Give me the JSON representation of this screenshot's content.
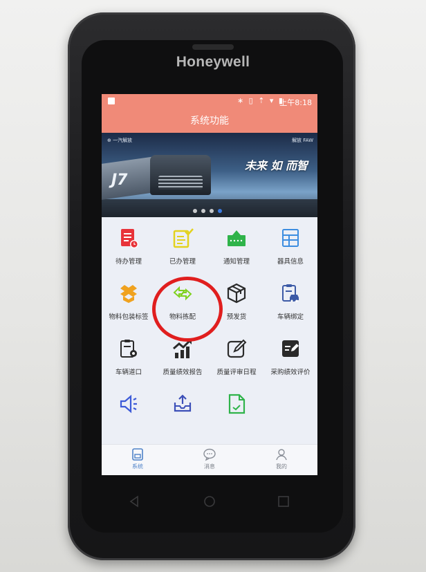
{
  "device": {
    "brand": "Honeywell"
  },
  "status_bar": {
    "icons": "∗ ▯ ⇡ ▾ ▮",
    "time": "上午8:18"
  },
  "header": {
    "title": "系统功能"
  },
  "banner": {
    "top_left": "⊕ 一汽解放",
    "top_right": "解放 FAW",
    "slogan": "未来 如 而智",
    "model": "J7",
    "slides_total": 4,
    "active_slide": 4
  },
  "grid": {
    "items": [
      {
        "label": "待办管理",
        "icon": "todo-doc-icon",
        "color": "#e8333a"
      },
      {
        "label": "已办管理",
        "icon": "done-doc-icon",
        "color": "#e3d21e"
      },
      {
        "label": "通知管理",
        "icon": "notice-box-icon",
        "color": "#2fb34a"
      },
      {
        "label": "器具信息",
        "icon": "equipment-form-icon",
        "color": "#3c8de0"
      },
      {
        "label": "物料包装标签",
        "icon": "package-box-icon",
        "color": "#f0a21f"
      },
      {
        "label": "物料拣配",
        "icon": "exchange-arrows-icon",
        "color": "#7fd11f"
      },
      {
        "label": "预发货",
        "icon": "cube-box-icon",
        "color": "#2a2a2a"
      },
      {
        "label": "车辆绑定",
        "icon": "vehicle-binding-icon",
        "color": "#3c5aa6"
      },
      {
        "label": "车辆道口",
        "icon": "vehicle-gate-icon",
        "color": "#2a2a2a"
      },
      {
        "label": "质量绩效报告",
        "icon": "growth-chart-icon",
        "color": "#2a2a2a"
      },
      {
        "label": "质量评审日程",
        "icon": "edit-note-icon",
        "color": "#2a2a2a"
      },
      {
        "label": "采购绩效评价",
        "icon": "rating-card-icon",
        "color": "#2a2a2a"
      },
      {
        "label": "",
        "icon": "speaker-icon",
        "color": "#3c5ad8"
      },
      {
        "label": "",
        "icon": "upload-tray-icon",
        "color": "#3c4fb8"
      },
      {
        "label": "",
        "icon": "green-doc-icon",
        "color": "#2fb34a"
      }
    ]
  },
  "tabbar": {
    "tabs": [
      {
        "label": "系统",
        "icon": "system-icon"
      },
      {
        "label": "消息",
        "icon": "message-icon"
      },
      {
        "label": "我的",
        "icon": "profile-icon"
      }
    ],
    "active": "系统"
  },
  "annotation": {
    "highlight_color": "#e01e1e",
    "target": "物料拣配"
  }
}
